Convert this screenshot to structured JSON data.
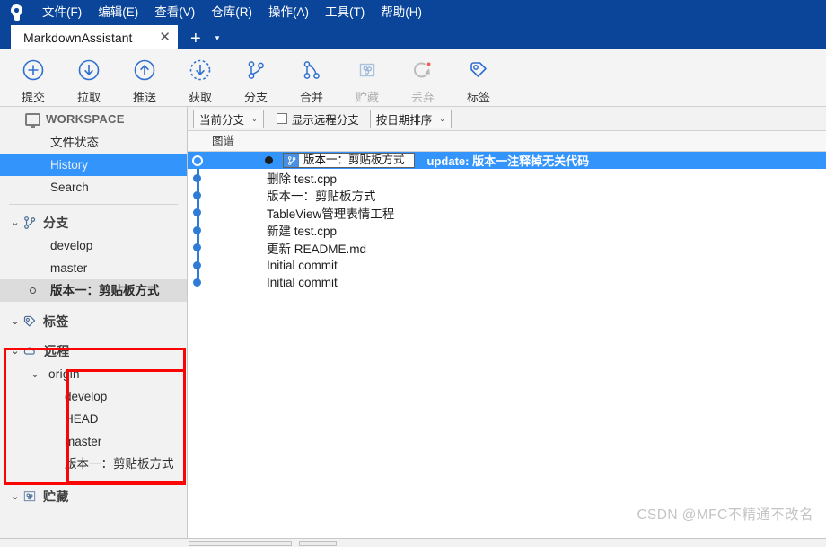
{
  "window": {
    "logo_icon": "sourcetree-logo-icon"
  },
  "menu": {
    "items": [
      {
        "label": "文件(F)",
        "mnemonic": "F"
      },
      {
        "label": "编辑(E)",
        "mnemonic": "E"
      },
      {
        "label": "查看(V)",
        "mnemonic": "V"
      },
      {
        "label": "仓库(R)",
        "mnemonic": "R"
      },
      {
        "label": "操作(A)",
        "mnemonic": "A"
      },
      {
        "label": "工具(T)",
        "mnemonic": "T"
      },
      {
        "label": "帮助(H)",
        "mnemonic": "H"
      }
    ]
  },
  "tabs": {
    "active_tab_label": "MarkdownAssistant",
    "close_label": "✕",
    "new_tab_label": "+",
    "dropdown_label": "▾"
  },
  "toolbar": {
    "buttons": [
      {
        "label": "提交",
        "icon": "commit-plus-icon",
        "disabled": false
      },
      {
        "label": "拉取",
        "icon": "pull-down-arrow-icon",
        "disabled": false
      },
      {
        "label": "推送",
        "icon": "push-up-arrow-icon",
        "disabled": false
      },
      {
        "label": "获取",
        "icon": "fetch-dashed-arrow-icon",
        "disabled": false
      },
      {
        "label": "分支",
        "icon": "branch-icon",
        "disabled": false
      },
      {
        "label": "合并",
        "icon": "merge-icon",
        "disabled": false
      },
      {
        "label": "贮藏",
        "icon": "stash-icon",
        "disabled": true
      },
      {
        "label": "丢弃",
        "icon": "discard-refresh-icon",
        "disabled": true
      },
      {
        "label": "标签",
        "icon": "tag-icon",
        "disabled": false
      }
    ]
  },
  "sidebar": {
    "workspace": {
      "title": "WORKSPACE",
      "icon": "monitor-icon",
      "items": [
        {
          "label": "文件状态",
          "selected": false
        },
        {
          "label": "History",
          "selected": true
        },
        {
          "label": "Search",
          "selected": false
        }
      ]
    },
    "branches": {
      "title": "分支",
      "icon": "branch-icon",
      "chevron": "⌄",
      "items": [
        {
          "label": "develop",
          "current": false
        },
        {
          "label": "master",
          "current": false
        },
        {
          "label": "版本一：剪贴板方式",
          "current": true
        }
      ]
    },
    "tags": {
      "title": "标签",
      "icon": "tag-icon",
      "chevron": "⌄",
      "items": []
    },
    "remotes": {
      "title": "远程",
      "icon": "cloud-icon",
      "chevron": "⌄",
      "origin": {
        "label": "origin",
        "chevron": "⌄",
        "items": [
          {
            "label": "develop"
          },
          {
            "label": "HEAD"
          },
          {
            "label": "master"
          },
          {
            "label": "版本一：剪贴板方式"
          }
        ]
      }
    },
    "stashes": {
      "title": "贮藏",
      "icon": "stash-icon",
      "chevron": "⌄"
    }
  },
  "annotations": {
    "color": "#fb0404",
    "boxes": [
      {
        "name": "remote-section-highlight"
      },
      {
        "name": "origin-subtree-highlight"
      }
    ]
  },
  "filterbar": {
    "branch_filter": "当前分支",
    "branch_filter_caret": "⌄",
    "show_remote_branches_label": "显示远程分支",
    "show_remote_branches_checked": false,
    "sort_label": "按日期排序",
    "sort_caret": "⌄"
  },
  "commit_table": {
    "columns": [
      {
        "label": "图谱"
      },
      {
        "label": ""
      }
    ],
    "rows": [
      {
        "message": "update: 版本一注释掉无关代码",
        "selected": true,
        "branch_badge": "版本一：剪贴板方式",
        "badge_icon": "branch-icon"
      },
      {
        "message": "删除 test.cpp",
        "selected": false
      },
      {
        "message": "版本一：剪贴板方式",
        "selected": false
      },
      {
        "message": "TableView管理表情工程",
        "selected": false
      },
      {
        "message": "新建 test.cpp",
        "selected": false
      },
      {
        "message": "更新 README.md",
        "selected": false
      },
      {
        "message": "Initial commit",
        "selected": false
      },
      {
        "message": "Initial commit",
        "selected": false
      }
    ]
  },
  "watermark": {
    "text": "CSDN @MFC不精通不改名"
  },
  "colors": {
    "titlebar": "#0a4599",
    "selection_blue": "#3394fb",
    "graph_blue": "#2e7cd6",
    "icon_blue": "#2f6fd0",
    "annotation_red": "#fb0404",
    "sidebar_bg": "#f2f2f2",
    "current_branch_bg": "#dcdcdc"
  }
}
